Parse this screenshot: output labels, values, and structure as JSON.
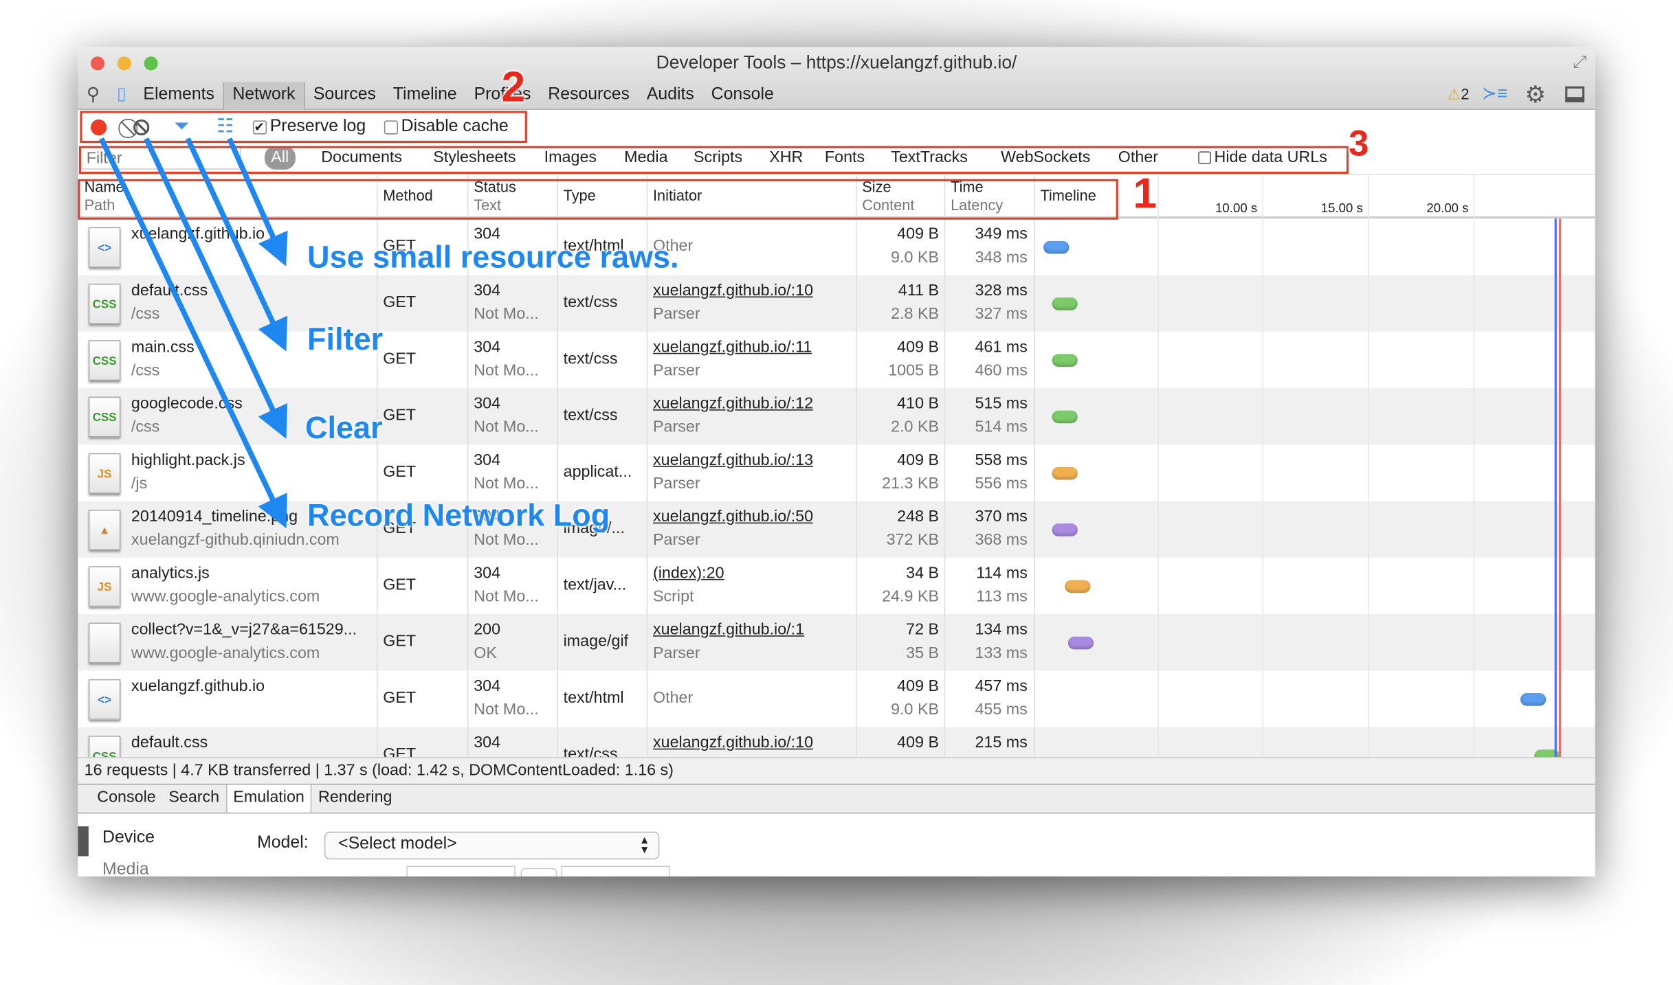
{
  "window": {
    "title": "Developer Tools – https://xuelangzf.github.io/"
  },
  "main_tabs": [
    "Elements",
    "Network",
    "Sources",
    "Timeline",
    "Profiles",
    "Resources",
    "Audits",
    "Console"
  ],
  "active_tab": "Network",
  "warnings": {
    "count": "2"
  },
  "toolbar": {
    "preserve_log": "Preserve log",
    "preserve_log_checked": true,
    "disable_cache": "Disable cache",
    "disable_cache_checked": false
  },
  "filter": {
    "placeholder": "Filter",
    "types": [
      "All",
      "Documents",
      "Stylesheets",
      "Images",
      "Media",
      "Scripts",
      "XHR",
      "Fonts",
      "TextTracks",
      "WebSockets",
      "Other"
    ],
    "hide_data_urls": "Hide data URLs"
  },
  "columns": {
    "name": "Name",
    "path": "Path",
    "method": "Method",
    "status": "Status",
    "text": "Text",
    "type": "Type",
    "initiator": "Initiator",
    "size": "Size",
    "content": "Content",
    "time": "Time",
    "latency": "Latency",
    "timeline": "Timeline"
  },
  "timeline_ticks": [
    "10.00 s",
    "15.00 s",
    "20.00 s"
  ],
  "requests": [
    {
      "name": "xuelangzf.github.io",
      "path": "",
      "icon": "html",
      "method": "GET",
      "status": "304",
      "text": "",
      "type": "text/html",
      "initiator": "Other",
      "initiator_sub": "",
      "size": "409 B",
      "content": "9.0 KB",
      "time": "349 ms",
      "latency": "348 ms",
      "color": "#5b9ef0"
    },
    {
      "name": "default.css",
      "path": "/css",
      "icon": "css",
      "method": "GET",
      "status": "304",
      "text": "Not Mo...",
      "type": "text/css",
      "initiator": "xuelangzf.github.io/:10",
      "initiator_sub": "Parser",
      "size": "411 B",
      "content": "2.8 KB",
      "time": "328 ms",
      "latency": "327 ms",
      "color": "#7ccb6a"
    },
    {
      "name": "main.css",
      "path": "/css",
      "icon": "css",
      "method": "GET",
      "status": "304",
      "text": "Not Mo...",
      "type": "text/css",
      "initiator": "xuelangzf.github.io/:11",
      "initiator_sub": "Parser",
      "size": "409 B",
      "content": "1005 B",
      "time": "461 ms",
      "latency": "460 ms",
      "color": "#7ccb6a"
    },
    {
      "name": "googlecode.css",
      "path": "/css",
      "icon": "css",
      "method": "GET",
      "status": "304",
      "text": "Not Mo...",
      "type": "text/css",
      "initiator": "xuelangzf.github.io/:12",
      "initiator_sub": "Parser",
      "size": "410 B",
      "content": "2.0 KB",
      "time": "515 ms",
      "latency": "514 ms",
      "color": "#7ccb6a"
    },
    {
      "name": "highlight.pack.js",
      "path": "/js",
      "icon": "js",
      "method": "GET",
      "status": "304",
      "text": "Not Mo...",
      "type": "applicat...",
      "initiator": "xuelangzf.github.io/:13",
      "initiator_sub": "Parser",
      "size": "409 B",
      "content": "21.3 KB",
      "time": "558 ms",
      "latency": "556 ms",
      "color": "#f0b050"
    },
    {
      "name": "20140914_timeline.png",
      "path": "xuelangzf-github.qiniudn.com",
      "icon": "img",
      "method": "GET",
      "status": "304",
      "text": "Not Mo...",
      "type": "image/...",
      "initiator": "xuelangzf.github.io/:50",
      "initiator_sub": "Parser",
      "size": "248 B",
      "content": "372 KB",
      "time": "370 ms",
      "latency": "368 ms",
      "color": "#a98ae0"
    },
    {
      "name": "analytics.js",
      "path": "www.google-analytics.com",
      "icon": "js",
      "method": "GET",
      "status": "304",
      "text": "Not Mo...",
      "type": "text/jav...",
      "initiator": "(index):20",
      "initiator_sub": "Script",
      "size": "34 B",
      "content": "24.9 KB",
      "time": "114 ms",
      "latency": "113 ms",
      "color": "#f0b050"
    },
    {
      "name": "collect?v=1&_v=j27&a=61529...",
      "path": "www.google-analytics.com",
      "icon": "blank",
      "method": "GET",
      "status": "200",
      "text": "OK",
      "type": "image/gif",
      "initiator": "xuelangzf.github.io/:1",
      "initiator_sub": "Parser",
      "size": "72 B",
      "content": "35 B",
      "time": "134 ms",
      "latency": "133 ms",
      "color": "#a98ae0"
    },
    {
      "name": "xuelangzf.github.io",
      "path": "",
      "icon": "html",
      "method": "GET",
      "status": "304",
      "text": "Not Mo...",
      "type": "text/html",
      "initiator": "Other",
      "initiator_sub": "",
      "size": "409 B",
      "content": "9.0 KB",
      "time": "457 ms",
      "latency": "455 ms",
      "color": "#5b9ef0"
    },
    {
      "name": "default.css",
      "path": "",
      "icon": "css",
      "method": "GET",
      "status": "304",
      "text": "",
      "type": "text/css",
      "initiator": "xuelangzf.github.io/:10",
      "initiator_sub": "",
      "size": "409 B",
      "content": "",
      "time": "215 ms",
      "latency": "",
      "color": "#7ccb6a"
    }
  ],
  "status_bar": "16 requests | 4.7 KB transferred | 1.37 s (load: 1.42 s, DOMContentLoaded: 1.16 s)",
  "drawer": {
    "tabs": [
      "Console",
      "Search",
      "Emulation",
      "Rendering"
    ],
    "active": "Emulation",
    "sections": [
      "Device",
      "Media"
    ],
    "model_label": "Model:",
    "model_value": "<Select model>"
  },
  "annotations": {
    "labels": [
      "Use small resource raws.",
      "Filter",
      "Clear",
      "Record Network Log"
    ],
    "numbers": [
      "1",
      "2",
      "3"
    ]
  }
}
